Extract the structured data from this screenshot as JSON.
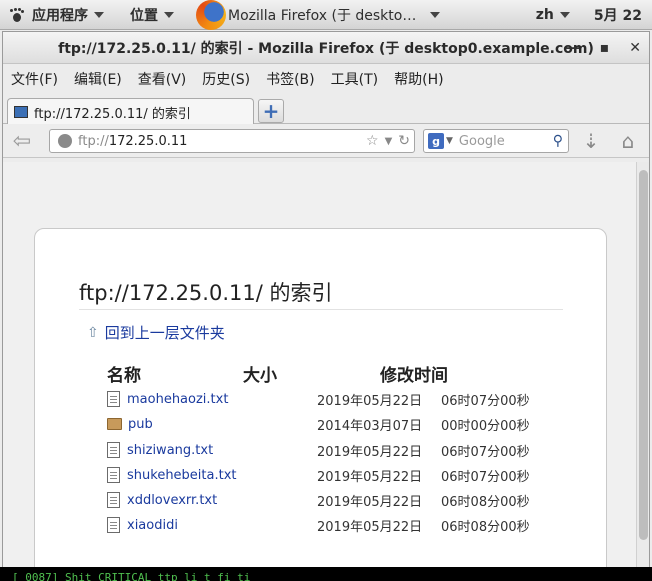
{
  "panel": {
    "apps_label": "应用程序",
    "places_label": "位置",
    "window_label": "Mozilla Firefox (于  deskto…",
    "input_method": "zh",
    "date": "5月 22"
  },
  "window": {
    "title": "ftp://172.25.0.11/ 的索引  -  Mozilla Firefox (于  desktop0.example.com)",
    "buttons": {
      "minimize": "—",
      "maximize": "▪",
      "close": "✕"
    }
  },
  "menubar": [
    "文件(F)",
    "编辑(E)",
    "查看(V)",
    "历史(S)",
    "书签(B)",
    "工具(T)",
    "帮助(H)"
  ],
  "tab": {
    "label": "ftp://172.25.0.11/ 的索引",
    "new_tab": "+"
  },
  "navbar": {
    "url_proto": "ftp://",
    "url_host": "172.25.0.11",
    "search_placeholder": "Google",
    "search_engine_letter": "g"
  },
  "page": {
    "heading": "ftp://172.25.0.11/ 的索引",
    "up_link": "回到上一层文件夹",
    "columns": {
      "name": "名称",
      "size": "大小",
      "modified": "修改时间"
    },
    "files": [
      {
        "name": "maohehaozi.txt",
        "type": "file",
        "date": "2019年05月22日",
        "time": "06时07分00秒"
      },
      {
        "name": "pub",
        "type": "folder",
        "date": "2014年03月07日",
        "time": "00时00分00秒"
      },
      {
        "name": "shiziwang.txt",
        "type": "file",
        "date": "2019年05月22日",
        "time": "06时07分00秒"
      },
      {
        "name": "shukehebeita.txt",
        "type": "file",
        "date": "2019年05月22日",
        "time": "06时07分00秒"
      },
      {
        "name": "xddlovexrr.txt",
        "type": "file",
        "date": "2019年05月22日",
        "time": "06时08分00秒"
      },
      {
        "name": "xiaodidi",
        "type": "file",
        "date": "2019年05月22日",
        "time": "06时08分00秒"
      }
    ]
  },
  "terminal": {
    "text": "[         0087]   Shit  CRITICAL  ttp   li    t   fi     ti"
  },
  "colors": {
    "link": "#1a3a9e",
    "terminal_text": "#4fbf4f"
  }
}
